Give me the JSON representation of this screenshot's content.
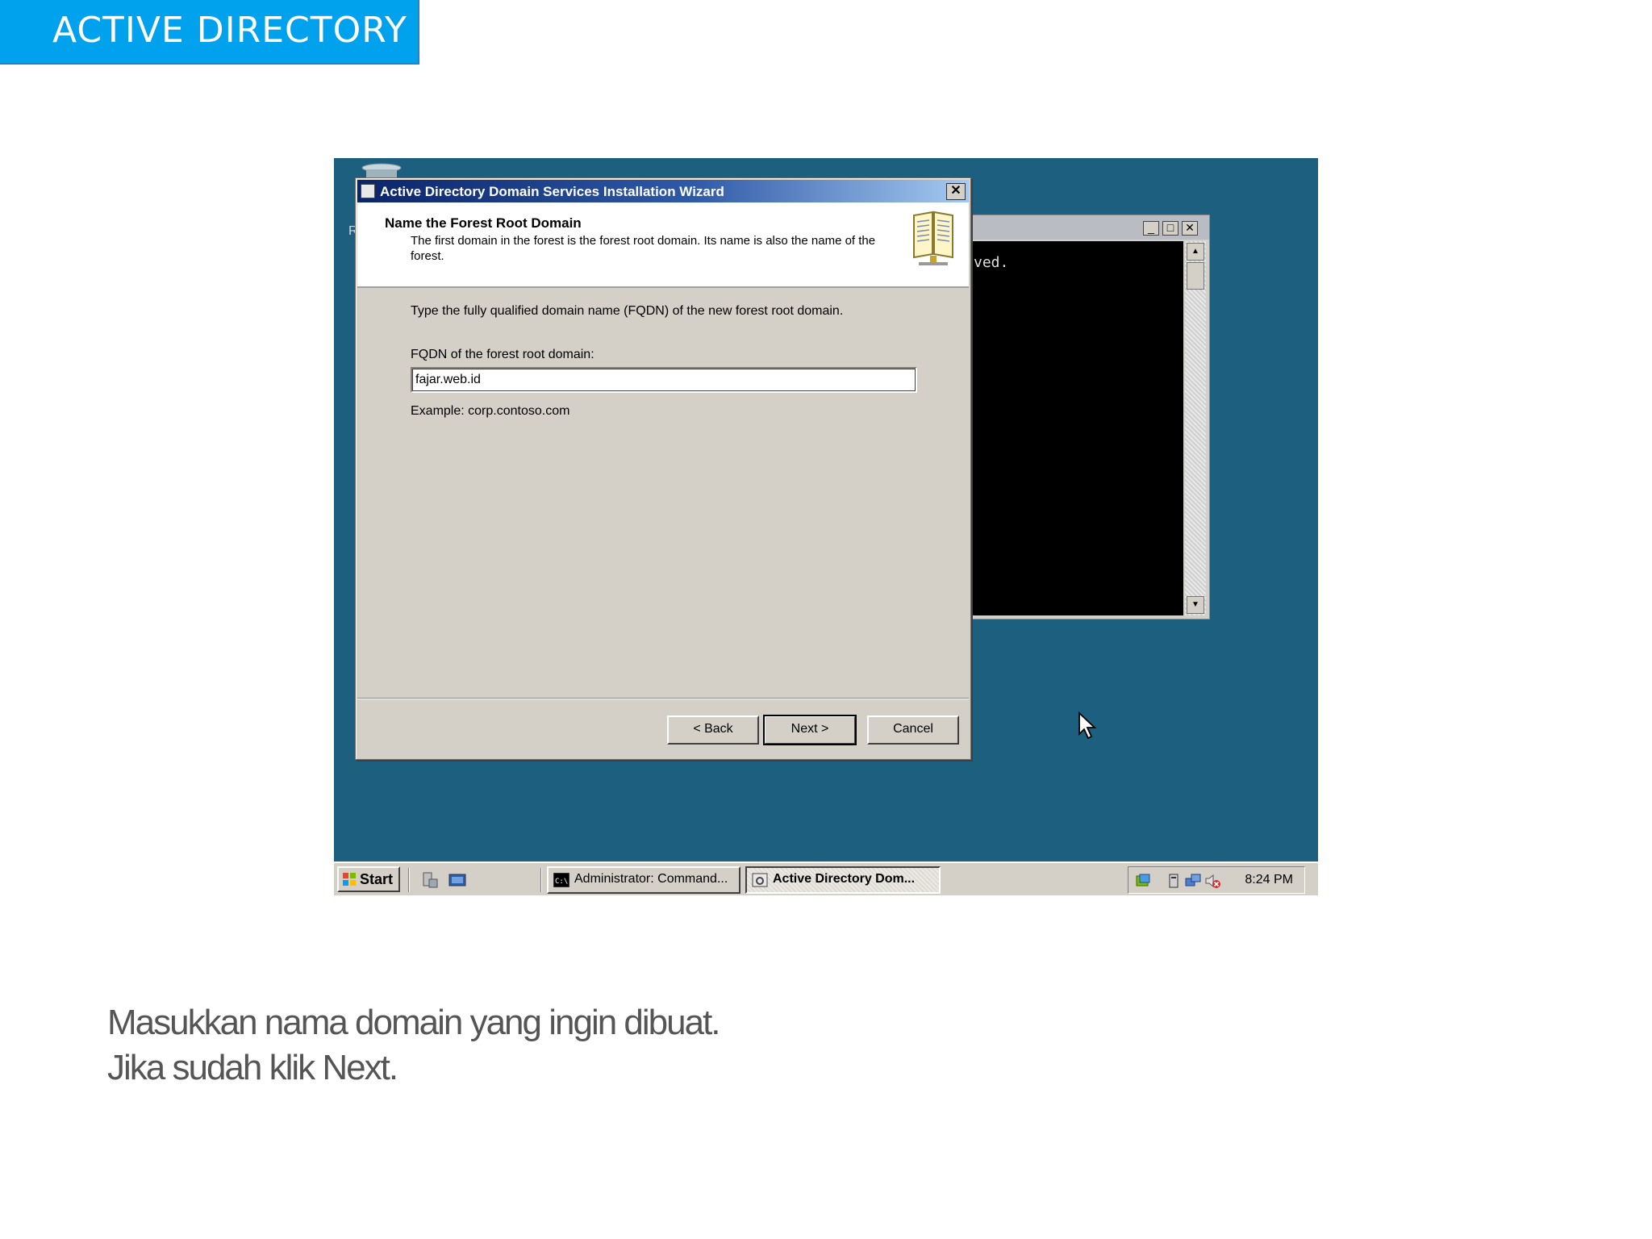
{
  "slide": {
    "title": "ACTIVE DIRECTORY",
    "caption_line1": "Masukkan nama domain yang ingin dibuat.",
    "caption_line2": "Jika sudah klik Next."
  },
  "colors": {
    "slide_title_bg": "#00a2ed",
    "desktop_bg": "#1d5f7e",
    "caption_text": "#555555"
  },
  "desktop": {
    "partial_letter": "R"
  },
  "cmd_window": {
    "output_text": "ved.",
    "minimize": "_",
    "maximize": "□",
    "close": "✕"
  },
  "wizard": {
    "title": "Active Directory Domain Services Installation Wizard",
    "close": "✕",
    "heading": "Name the Forest Root Domain",
    "description": "The first domain in the forest is the forest root domain. Its name is also the name of the forest.",
    "instruction": "Type the fully qualified domain name (FQDN) of the new forest root domain.",
    "fqdn_label": "FQDN of the forest root domain:",
    "fqdn_value": "fajar.web.id",
    "example": "Example: corp.contoso.com",
    "back_button": "< Back",
    "next_button": "Next >",
    "cancel_button": "Cancel"
  },
  "taskbar": {
    "start_label": "Start",
    "tasks": [
      {
        "label": "Administrator: Command...",
        "active": false,
        "icon": "cmd-icon"
      },
      {
        "label": "Active Directory Dom...",
        "active": true,
        "icon": "wizard-icon"
      }
    ],
    "clock": "8:24 PM"
  }
}
